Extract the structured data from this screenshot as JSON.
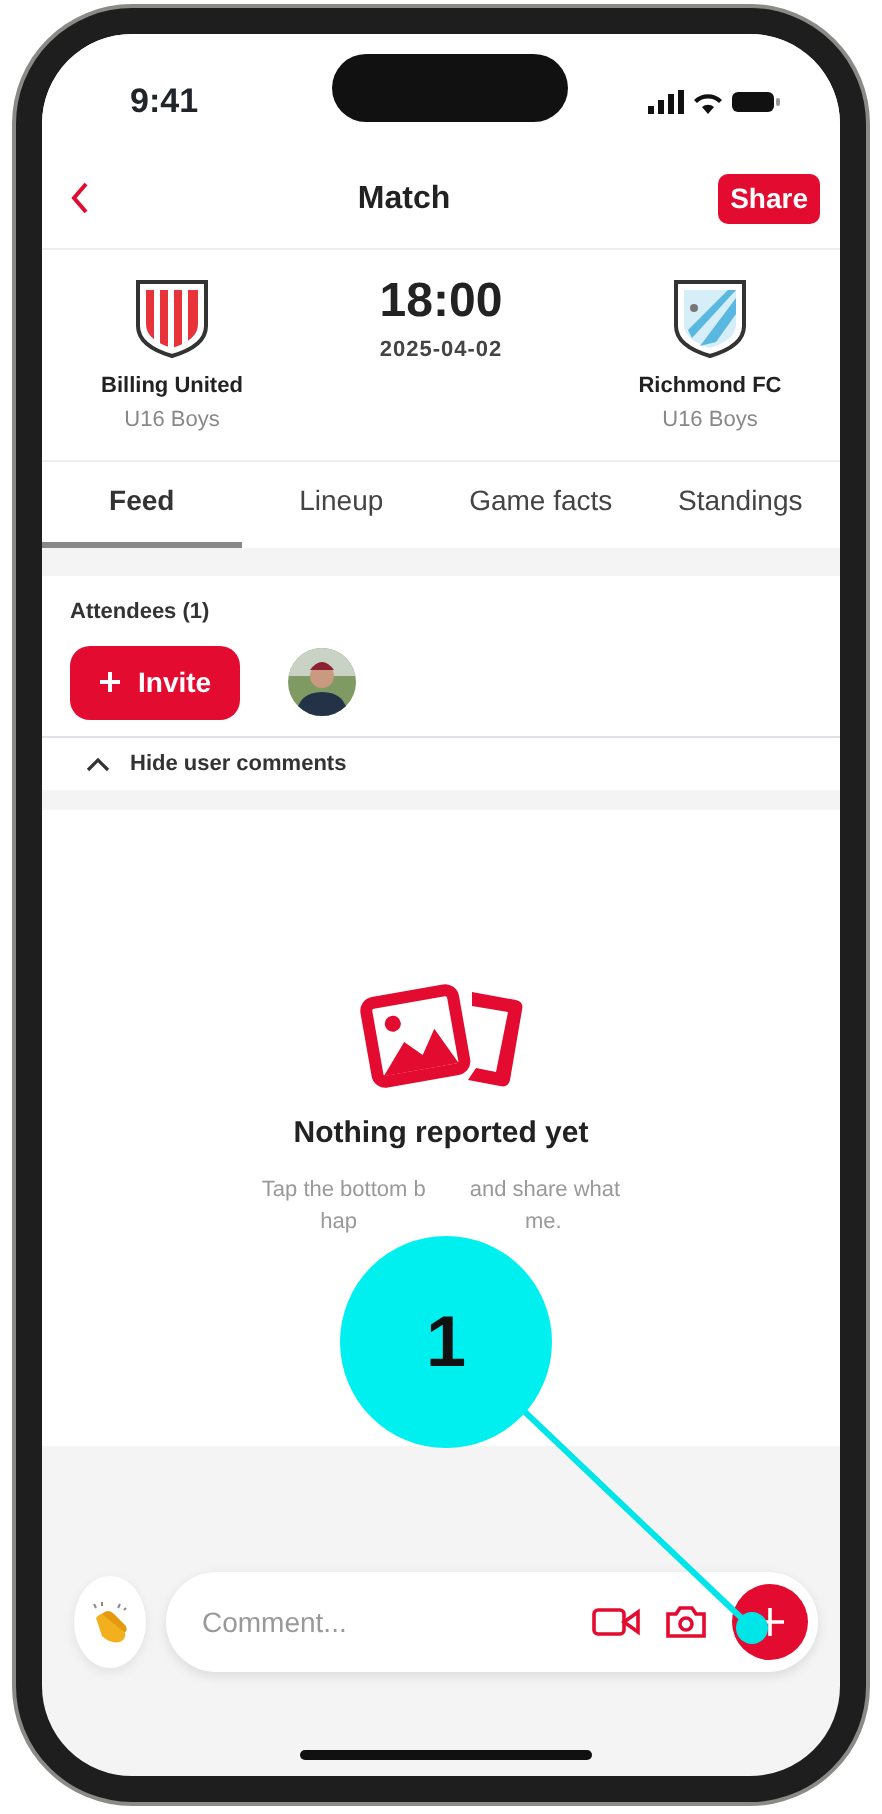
{
  "status_bar": {
    "time": "9:41"
  },
  "header": {
    "title": "Match",
    "share_button": "Share"
  },
  "match": {
    "home": {
      "name": "Billing United",
      "team": "U16 Boys"
    },
    "time": "18:00",
    "date": "2025-04-02",
    "away": {
      "name": "Richmond FC",
      "team": "U16 Boys"
    }
  },
  "tabs": [
    {
      "label": "Feed",
      "selected": true
    },
    {
      "label": "Lineup",
      "selected": false
    },
    {
      "label": "Game facts",
      "selected": false
    },
    {
      "label": "Standings",
      "selected": false
    }
  ],
  "attendees": {
    "title": "Attendees (1)",
    "invite_button": "Invite"
  },
  "comments_toggle": {
    "label": "Hide user comments",
    "expanded": true
  },
  "empty_state": {
    "title": "Nothing reported yet",
    "hint_lines": [
      [
        "Tap the bottom b",
        "and share what"
      ],
      [
        "hap",
        "me."
      ]
    ]
  },
  "composer": {
    "placeholder": "Comment..."
  },
  "callout": {
    "label": "1"
  }
}
